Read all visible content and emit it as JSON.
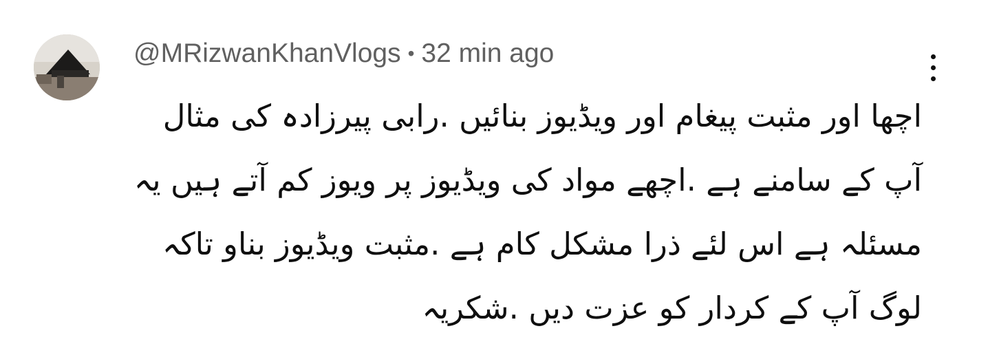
{
  "comment": {
    "author": "@MRizwanKhanVlogs",
    "separator": "•",
    "time": "32 min ago",
    "text": "اچھا اور مثبت پیغام اور ویڈیوز بنائیں .رابی پیرزادہ کی مثال آپ کے سامنے ہے .اچھے مواد کی ویڈیوز پر ویوز کم آتے ہیں یہ مسئلہ ہے اس لئے ذرا مشکل کام ہے .مثبت ویڈیوز بناو تاکہ لوگ آپ کے کردار کو عزت دیں .شکریہ",
    "menu_icon": "more-vertical-icon",
    "avatar_icon": "avatar-photo"
  }
}
